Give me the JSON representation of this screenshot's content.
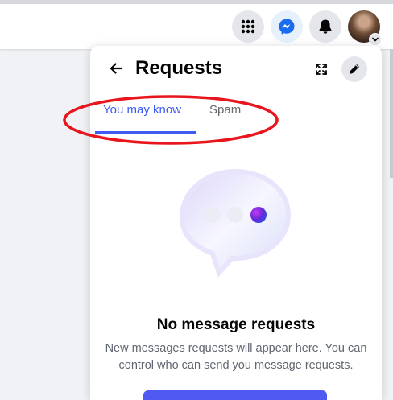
{
  "navbar": {
    "menu_icon": "apps-grid-icon",
    "messenger_icon": "messenger-icon",
    "notifications_icon": "bell-icon",
    "profile_icon": "avatar",
    "account_icon": "chevron-down-icon"
  },
  "panel": {
    "title": "Requests",
    "back_icon": "arrow-left-icon",
    "expand_icon": "expand-icon",
    "edit_icon": "pencil-icon",
    "tabs": [
      {
        "label": "You may know",
        "active": true
      },
      {
        "label": "Spam",
        "active": false
      }
    ],
    "empty_state": {
      "illustration_icon": "chat-bubble-icon",
      "title": "No message requests",
      "description": "New messages requests will appear here. You can control who can send you message requests."
    }
  },
  "colors": {
    "accent": "#3e5cf4",
    "annotation": "#e8161c",
    "button_bg": "#e4e6eb",
    "messenger_blue": "#1a6cf0"
  }
}
